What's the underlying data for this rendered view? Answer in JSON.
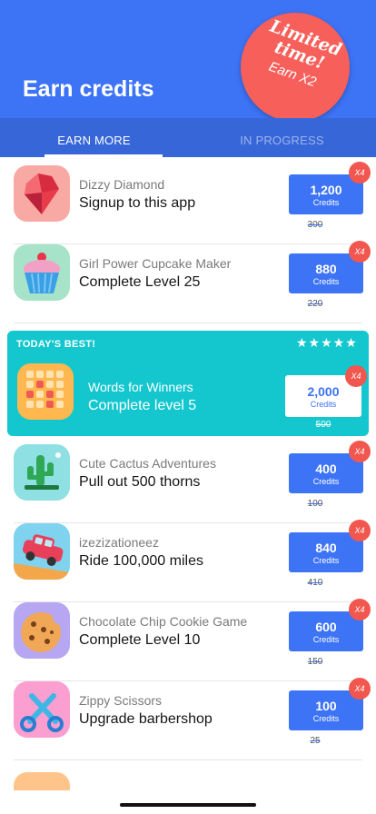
{
  "header": {
    "title": "Earn credits",
    "promo": {
      "line1": "Limited time!",
      "line2": "Earn X2"
    }
  },
  "tabs": [
    {
      "label": "EARN MORE",
      "active": true
    },
    {
      "label": "IN PROGRESS",
      "active": false
    }
  ],
  "credits_label": "Credits",
  "multiplier_badge": "X4",
  "offers": [
    {
      "app": "Dizzy Diamond",
      "task": "Signup to this app",
      "credits": "1,200",
      "old_credits": "300",
      "icon": "diamond-icon"
    },
    {
      "app": "Girl Power Cupcake Maker",
      "task": "Complete Level 25",
      "credits": "880",
      "old_credits": "220",
      "icon": "cupcake-icon"
    },
    {
      "app": "Cute Cactus Adventures",
      "task": "Pull out 500 thorns",
      "credits": "400",
      "old_credits": "100",
      "icon": "cactus-icon"
    },
    {
      "app": "izezizationeez",
      "task": "Ride 100,000 miles",
      "credits": "840",
      "old_credits": "410",
      "icon": "car-icon"
    },
    {
      "app": "Chocolate Chip Cookie Game",
      "task": "Complete Level 10",
      "credits": "600",
      "old_credits": "150",
      "icon": "cookie-icon"
    },
    {
      "app": "Zippy Scissors",
      "task": "Upgrade barbershop",
      "credits": "100",
      "old_credits": "25",
      "icon": "scissors-icon"
    }
  ],
  "featured": {
    "label": "TODAY'S BEST!",
    "rating_stars": 5,
    "stars": "★★★★★",
    "app": "Words for Winners",
    "task": "Complete level 5",
    "credits": "2,000",
    "old_credits": "500",
    "icon": "word-grid-icon"
  },
  "colors": {
    "brand_blue": "#3d73f5",
    "tab_bar": "#3766d8",
    "featured_teal": "#14c7cf",
    "badge_red": "#f2574f",
    "promo_red": "#f75f5a"
  }
}
